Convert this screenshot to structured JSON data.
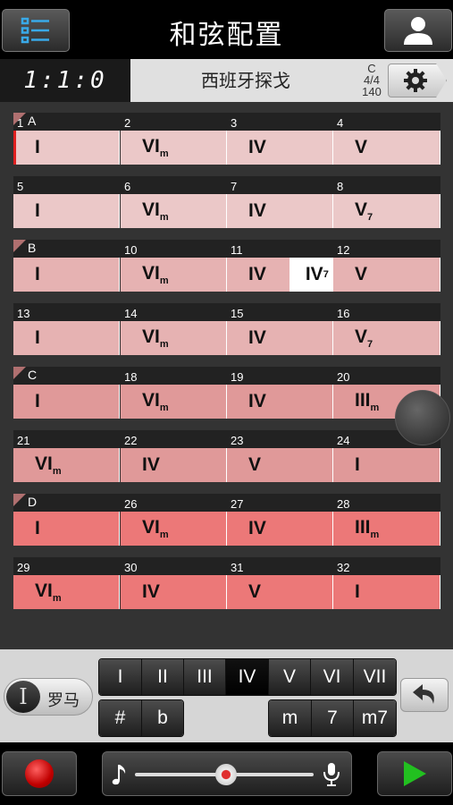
{
  "header": {
    "title": "和弦配置"
  },
  "info": {
    "position": "1:1:0",
    "style": "西班牙探戈",
    "key": "C",
    "time_sig": "4/4",
    "tempo": "140"
  },
  "rows": [
    {
      "section": "A",
      "color": "#ebc8c8",
      "bars": [
        {
          "num": "1",
          "chord": "I",
          "sub": ""
        },
        {
          "num": "2",
          "chord": "VI",
          "sub": "m"
        },
        {
          "num": "3",
          "chord": "IV",
          "sub": ""
        },
        {
          "num": "4",
          "chord": "V",
          "sub": ""
        }
      ]
    },
    {
      "section": "",
      "color": "#ebc8c8",
      "bars": [
        {
          "num": "5",
          "chord": "I",
          "sub": ""
        },
        {
          "num": "6",
          "chord": "VI",
          "sub": "m"
        },
        {
          "num": "7",
          "chord": "IV",
          "sub": ""
        },
        {
          "num": "8",
          "chord": "V",
          "sub": "7"
        }
      ]
    },
    {
      "section": "B",
      "color": "#e6b2b2",
      "bars": [
        {
          "num": "",
          "chord": "I",
          "sub": ""
        },
        {
          "num": "10",
          "chord": "VI",
          "sub": "m"
        },
        {
          "num": "11",
          "chord": "IV",
          "sub": "",
          "extra": {
            "chord": "IV",
            "sub": "7"
          }
        },
        {
          "num": "12",
          "chord": "V",
          "sub": ""
        }
      ]
    },
    {
      "section": "",
      "color": "#e6b2b2",
      "bars": [
        {
          "num": "13",
          "chord": "I",
          "sub": ""
        },
        {
          "num": "14",
          "chord": "VI",
          "sub": "m"
        },
        {
          "num": "15",
          "chord": "IV",
          "sub": ""
        },
        {
          "num": "16",
          "chord": "V",
          "sub": "7"
        }
      ]
    },
    {
      "section": "C",
      "color": "#e09999",
      "bars": [
        {
          "num": "",
          "chord": "I",
          "sub": ""
        },
        {
          "num": "18",
          "chord": "VI",
          "sub": "m"
        },
        {
          "num": "19",
          "chord": "IV",
          "sub": ""
        },
        {
          "num": "20",
          "chord": "III",
          "sub": "m"
        }
      ]
    },
    {
      "section": "",
      "color": "#e09999",
      "bars": [
        {
          "num": "21",
          "chord": "VI",
          "sub": "m"
        },
        {
          "num": "22",
          "chord": "IV",
          "sub": ""
        },
        {
          "num": "23",
          "chord": "V",
          "sub": ""
        },
        {
          "num": "24",
          "chord": "I",
          "sub": ""
        }
      ]
    },
    {
      "section": "D",
      "color": "#ec7878",
      "bars": [
        {
          "num": "",
          "chord": "I",
          "sub": ""
        },
        {
          "num": "26",
          "chord": "VI",
          "sub": "m"
        },
        {
          "num": "27",
          "chord": "IV",
          "sub": ""
        },
        {
          "num": "28",
          "chord": "III",
          "sub": "m"
        }
      ]
    },
    {
      "section": "",
      "color": "#ec7878",
      "bars": [
        {
          "num": "29",
          "chord": "VI",
          "sub": "m"
        },
        {
          "num": "30",
          "chord": "IV",
          "sub": ""
        },
        {
          "num": "31",
          "chord": "V",
          "sub": ""
        },
        {
          "num": "32",
          "chord": "I",
          "sub": ""
        }
      ]
    }
  ],
  "panel": {
    "mode_label": "罗马",
    "mode_icon": "I",
    "degrees": [
      "I",
      "II",
      "III",
      "IV",
      "V",
      "VI",
      "VII"
    ],
    "active_degree": "IV",
    "accidentals": [
      "#",
      "b"
    ],
    "qualities": [
      "m",
      "7",
      "m7"
    ]
  },
  "colors": {
    "record": "#d01010",
    "play": "#22c020"
  }
}
